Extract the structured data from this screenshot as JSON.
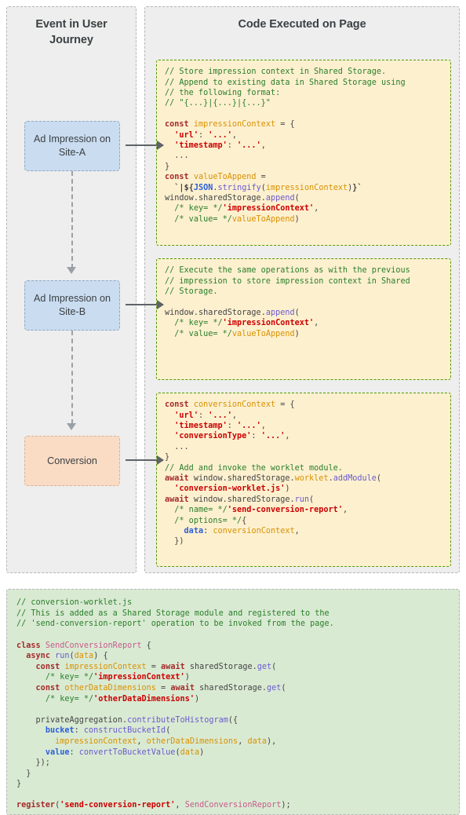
{
  "diagram": {
    "left_panel": {
      "title": "Event in User Journey",
      "steps": [
        {
          "id": "ad-impression-site-a",
          "label": "Ad Impression on Site-A",
          "color": "#c9dcf0"
        },
        {
          "id": "ad-impression-site-b",
          "label": "Ad Impression on Site-B",
          "color": "#c9dcf0"
        },
        {
          "id": "conversion",
          "label": "Conversion",
          "color": "#fadcc5"
        }
      ]
    },
    "right_panel": {
      "title": "Code Executed on Page",
      "code_blocks": [
        {
          "id": "impression-site-a-code",
          "background": "#fdf0cf",
          "border_color": "#4e9a06",
          "code": "// Store impression context in Shared Storage.\n// Append to existing data in Shared Storage using\n// the following format:\n// \"{...}|{...}|{...}\"\n\nconst impressionContext = {\n  'url': '...',\n  'timestamp': '...',\n  ...\n}\nconst valueToAppend =\n  `|${JSON.stringify(impressionContext)}`\nwindow.sharedStorage.append(\n  /* key= */'impressionContext',\n  /* value= */valueToAppend)"
        },
        {
          "id": "impression-site-b-code",
          "background": "#fdf0cf",
          "border_color": "#4e9a06",
          "code": "// Execute the same operations as with the previous\n// impression to store impression context in Shared\n// Storage.\n\nwindow.sharedStorage.append(\n  /* key= */'impressionContext',\n  /* value= */valueToAppend)"
        },
        {
          "id": "conversion-code",
          "background": "#fdf0cf",
          "border_color": "#4e9a06",
          "code": "const conversionContext = {\n  'url': '...',\n  'timestamp': '...',\n  'conversionType': '...',\n  ...\n}\n// Add and invoke the worklet module.\nawait window.sharedStorage.worklet.addModule(\n  'conversion-worklet.js')\nawait window.sharedStorage.run(\n  /* name= */'send-conversion-report',\n  /* options= */{\n    data: conversionContext,\n  })"
        }
      ]
    },
    "worklet_block": {
      "id": "conversion-worklet-code",
      "background": "#d9ead3",
      "code": "// conversion-worklet.js\n// This is added as a Shared Storage module and registered to the\n// 'send-conversion-report' operation to be invoked from the page.\n\nclass SendConversionReport {\n  async run(data) {\n    const impressionContext = await sharedStorage.get(\n      /* key= */'impressionContext')\n    const otherDataDimensions = await sharedStorage.get(\n      /* key= */'otherDataDimensions')\n\n    privateAggregation.contributeToHistogram({\n      bucket: constructBucketId(\n        impressionContext, otherDataDimensions, data),\n      value: convertToBucketValue(data)\n    });\n  }\n}\n\nregister('send-conversion-report', SendConversionReport);"
    },
    "connectors": [
      {
        "id": "impression-a-to-code",
        "type": "arrow-right"
      },
      {
        "id": "impression-b-to-code",
        "type": "arrow-right"
      },
      {
        "id": "conversion-to-code",
        "type": "arrow-right"
      },
      {
        "id": "impression-a-to-impression-b",
        "type": "arrow-down-dashed"
      },
      {
        "id": "impression-b-to-conversion",
        "type": "arrow-down-dashed"
      }
    ]
  }
}
